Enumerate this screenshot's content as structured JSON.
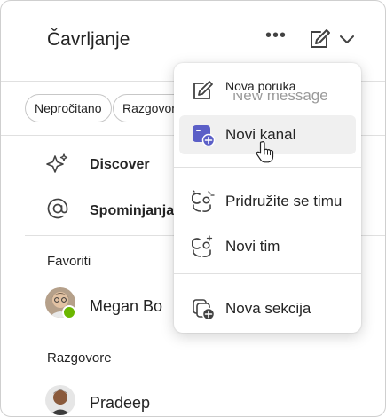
{
  "header": {
    "title": "Čavrljanje",
    "more_glyph": "•••",
    "compose_icon": "compose-icon",
    "chevron_icon": "chevron-down-icon"
  },
  "filters": [
    "Nepročitano",
    "Razgovore"
  ],
  "nav": [
    {
      "label": "Discover",
      "icon": "sparkle-icon"
    },
    {
      "label": "Spominjanja",
      "icon": "at-icon"
    }
  ],
  "sections": {
    "favorites": "Favoriti",
    "chats": "Razgovore"
  },
  "favorites": [
    {
      "name": "Megan Bo",
      "status": "available",
      "status_color": "#6bb700"
    }
  ],
  "chats": [
    {
      "name": "Pradeep"
    }
  ],
  "menu": {
    "items": [
      {
        "label": "Nova poruka",
        "overlap_label": "New message",
        "icon": "compose-icon"
      },
      {
        "label": "Novi kanal",
        "icon": "new-channel-icon",
        "highlighted": true
      },
      {
        "label": "Pridružite se timu",
        "icon": "join-team-icon"
      },
      {
        "label": "Novi tim",
        "icon": "new-team-icon"
      },
      {
        "label": "Nova sekcija",
        "icon": "new-section-icon"
      }
    ]
  },
  "colors": {
    "accent": "#5b5fc7",
    "text": "#242424",
    "menu_highlight": "#f0f0f0"
  }
}
